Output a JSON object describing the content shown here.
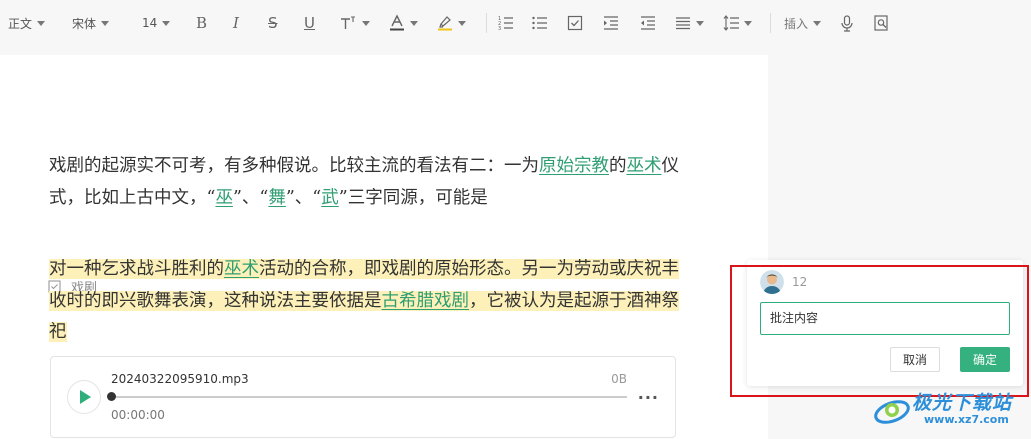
{
  "toolbar": {
    "style_select": "正文",
    "font_select": "宋体",
    "size_select": "14",
    "insert_label": "插入"
  },
  "document": {
    "para1": {
      "t1": "戏剧的起源实不可考，有多种假说。比较主流的看法有二：一为",
      "link1": "原始宗教",
      "t2": "的",
      "link2": "巫术",
      "t3": "仪式，比如上古中文，“",
      "link3": "巫",
      "t4": "”、“",
      "link4": "舞",
      "t5": "”、“",
      "link5": "武",
      "t6": "”三字同源，可能是"
    },
    "tag_label": "戏剧",
    "para2": {
      "t1": "对一种乞求战斗胜利的",
      "link1": "巫术",
      "t2": "活动的合称，即戏剧的原始形态。另一为劳动或庆祝丰收时的即兴歌舞表演，这种说法主要依据是",
      "link2": "古希腊戏剧",
      "t3": "，它被认为是起源于酒神祭祀"
    }
  },
  "audio": {
    "filename": "20240322095910.mp3",
    "size": "0B",
    "time": "00:00:00",
    "progress": 0
  },
  "comment": {
    "user": "12",
    "input_value": "批注内容",
    "cancel_label": "取消",
    "ok_label": "确定"
  },
  "watermark": {
    "title": "极光下载站",
    "url": "www.xz7.com"
  },
  "colors": {
    "accent": "#35b07f",
    "highlight": "#fdf1b9",
    "link": "#2f9e72",
    "annotation_box": "#d9151b"
  }
}
